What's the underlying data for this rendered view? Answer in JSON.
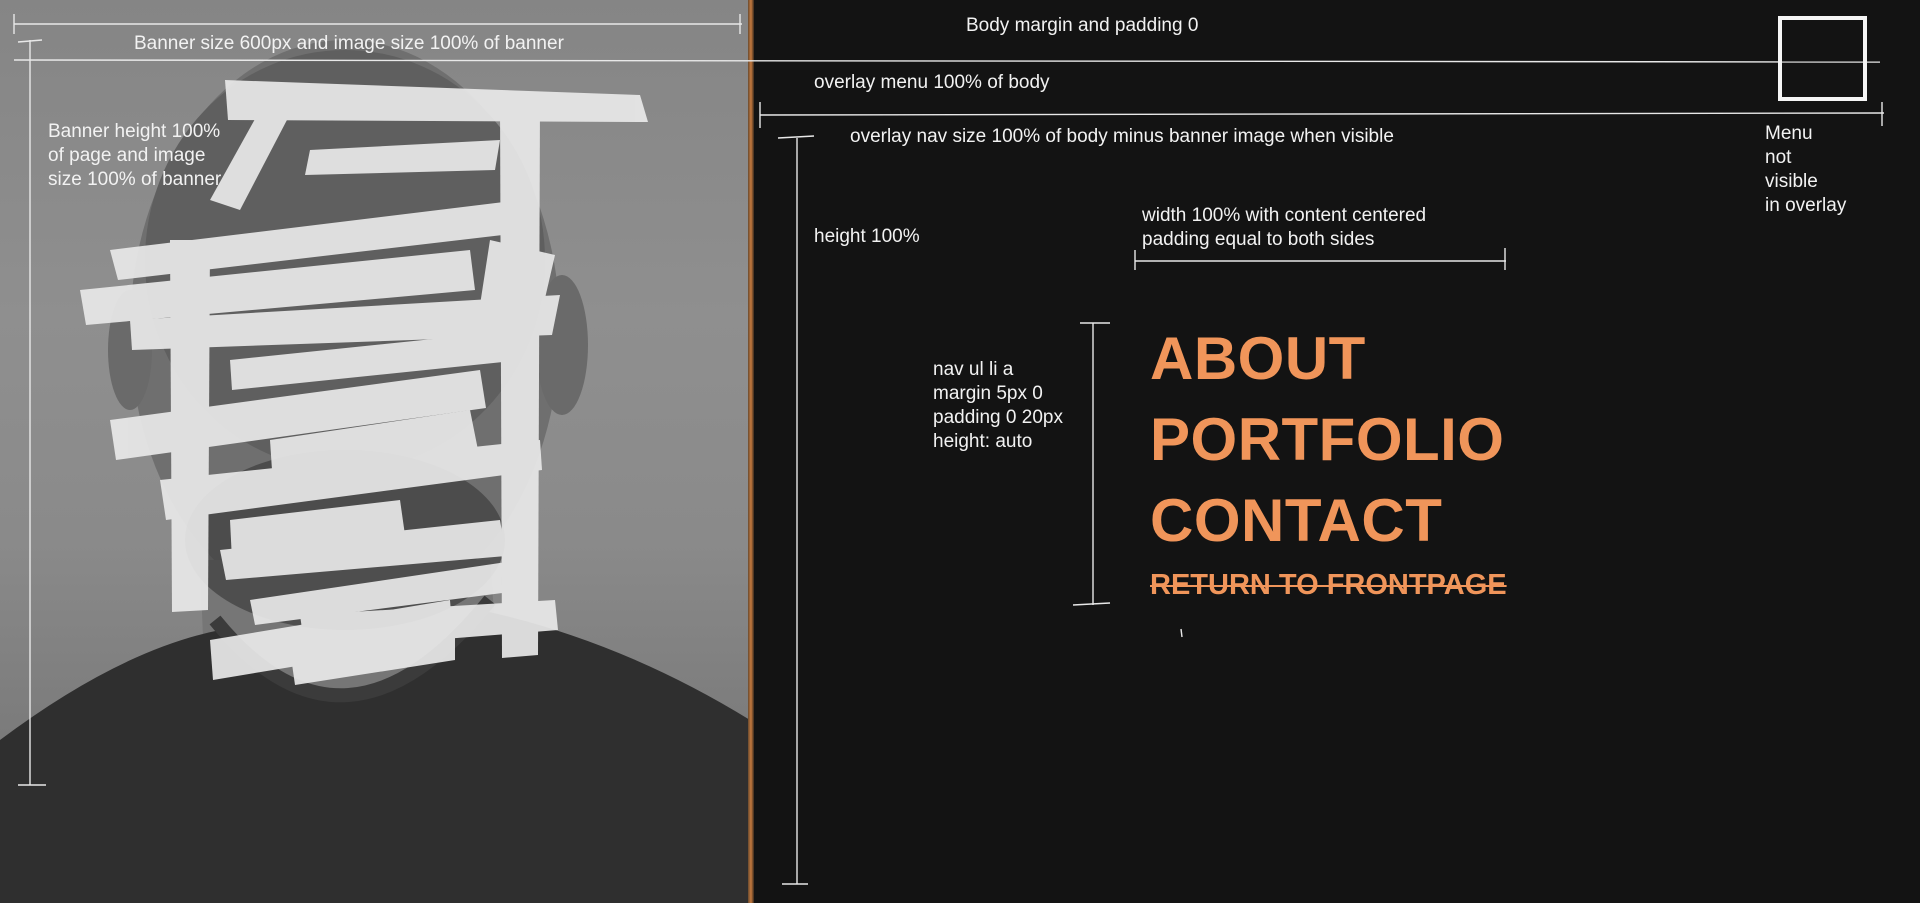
{
  "annotations": {
    "body_margin": "Body margin and padding 0",
    "banner_size": "Banner size 600px and image size 100% of banner",
    "banner_height": "Banner height 100%\nof page and image\nsize 100% of banner",
    "overlay_menu": "overlay menu 100% of body",
    "overlay_nav": "overlay nav size 100% of body minus banner image when visible",
    "height": "height 100%",
    "width_centered": "width 100% with content centered\npadding equal to both sides",
    "nav_li": "nav ul li a\nmargin 5px 0\npadding 0 20px\nheight: auto",
    "menu_not_visible": "Menu\nnot\nvisible\nin overlay"
  },
  "nav": {
    "items": [
      {
        "label": "ABOUT"
      },
      {
        "label": "PORTFOLIO"
      },
      {
        "label": "CONTACT"
      }
    ],
    "return_label": "RETURN TO FRONTPAGE"
  },
  "colors": {
    "background": "#131313",
    "accent": "#f0955a",
    "annotation": "#f2f2f2"
  },
  "icons": {
    "menu_toggle": "menu-toggle-box"
  }
}
